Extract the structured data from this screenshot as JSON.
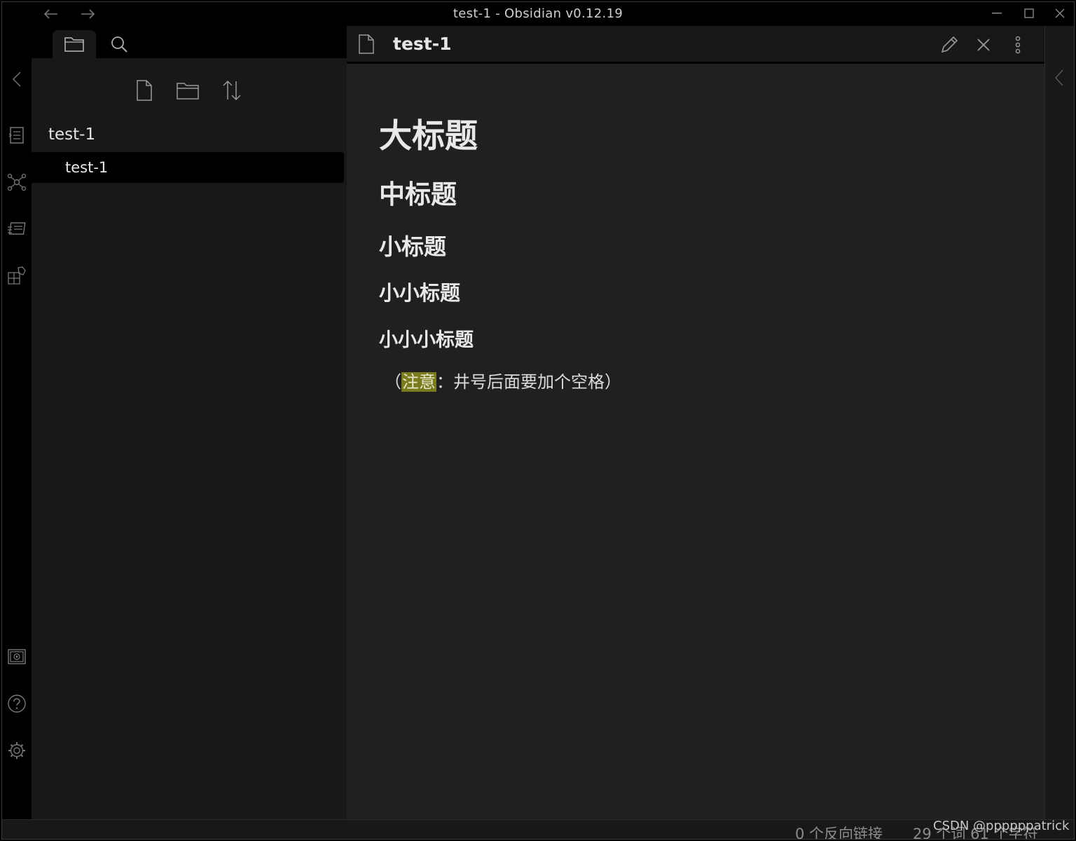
{
  "window": {
    "title": "test-1 - Obsidian v0.12.19"
  },
  "sidebar": {
    "folder_name": "test-1",
    "file_name": "test-1"
  },
  "editor": {
    "tab_title": "test-1",
    "heading1": "大标题",
    "heading2": "中标题",
    "heading3": "小标题",
    "heading4": "小小标题",
    "heading5": "小小小标题",
    "note_open": "（",
    "note_highlight": "注意",
    "note_rest": "：井号后面要加个空格）"
  },
  "statusbar": {
    "backlinks": "0 个反向链接",
    "counts": "29 个词 61 个字符"
  },
  "watermark": "CSDN @ppppppatrick",
  "colors": {
    "highlight": "#7a7a1e",
    "background": "#202020",
    "pane": "#181818"
  }
}
